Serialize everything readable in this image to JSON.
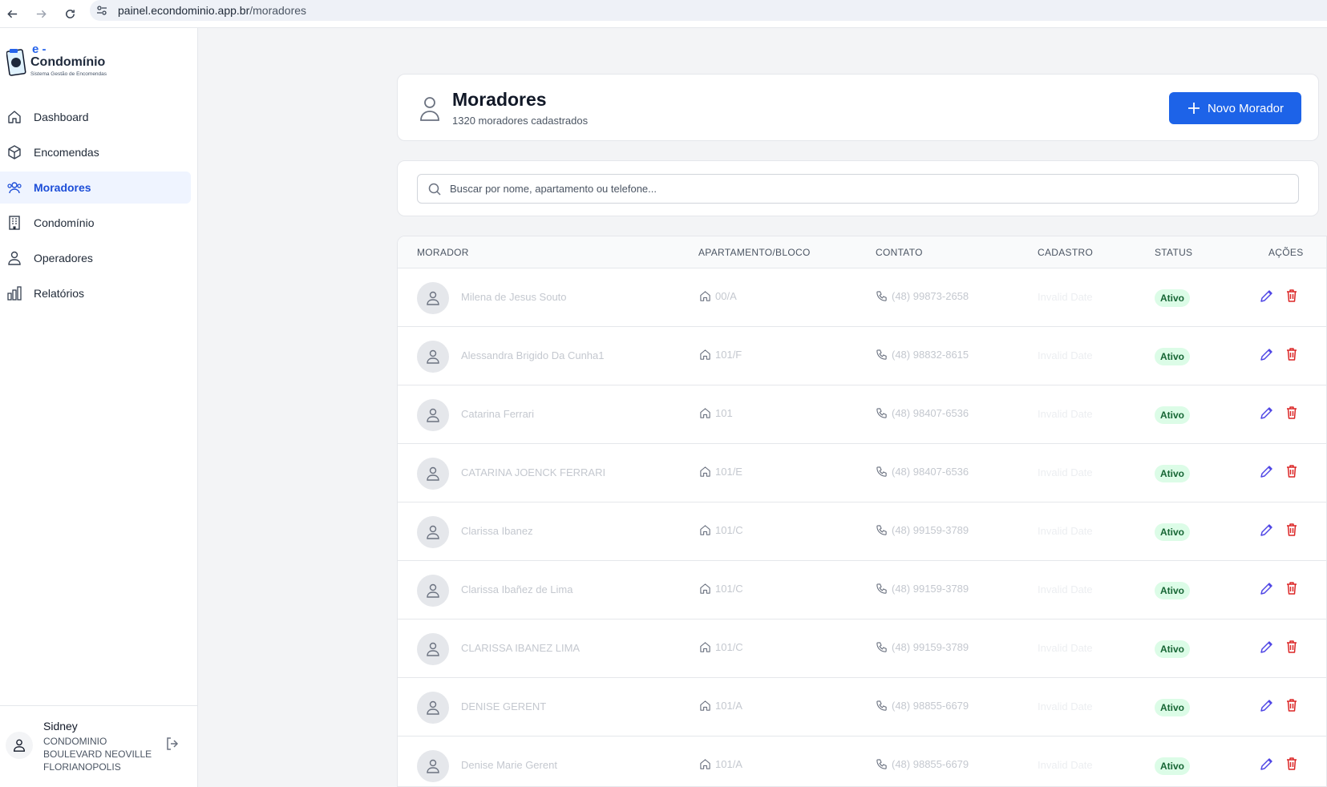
{
  "browser": {
    "url_host": "painel.econdominio.app.br",
    "url_path": "/moradores"
  },
  "sidebar": {
    "logo": {
      "e": "e -",
      "title": "Condomínio",
      "subtitle": "Sistema Gestão de Encomendas"
    },
    "items": [
      {
        "label": "Dashboard",
        "icon": "home-icon"
      },
      {
        "label": "Encomendas",
        "icon": "package-icon"
      },
      {
        "label": "Moradores",
        "icon": "users-icon",
        "active": true
      },
      {
        "label": "Condomínio",
        "icon": "building-icon"
      },
      {
        "label": "Operadores",
        "icon": "user-icon"
      },
      {
        "label": "Relatórios",
        "icon": "bar-chart-icon"
      }
    ],
    "user": {
      "name": "Sidney",
      "org": "CONDOMINIO BOULEVARD NEOVILLE FLORIANOPOLIS"
    }
  },
  "header": {
    "title": "Moradores",
    "subtitle": "1320 moradores cadastrados",
    "new_button": "Novo Morador"
  },
  "search": {
    "placeholder": "Buscar por nome, apartamento ou telefone..."
  },
  "table": {
    "columns": [
      "MORADOR",
      "APARTAMENTO/BLOCO",
      "CONTATO",
      "CADASTRO",
      "STATUS",
      "AÇÕES"
    ],
    "rows": [
      {
        "name": "Milena de Jesus Souto",
        "apt": "00/A",
        "phone": "(48) 99873-2658",
        "date": "Invalid Date",
        "status": "Ativo"
      },
      {
        "name": "Alessandra Brigido Da Cunha1",
        "apt": "101/F",
        "phone": "(48) 98832-8615",
        "date": "Invalid Date",
        "status": "Ativo"
      },
      {
        "name": "Catarina Ferrari",
        "apt": "101",
        "phone": "(48) 98407-6536",
        "date": "Invalid Date",
        "status": "Ativo"
      },
      {
        "name": "CATARINA JOENCK FERRARI",
        "apt": "101/E",
        "phone": "(48) 98407-6536",
        "date": "Invalid Date",
        "status": "Ativo"
      },
      {
        "name": "Clarissa Ibanez",
        "apt": "101/C",
        "phone": "(48) 99159-3789",
        "date": "Invalid Date",
        "status": "Ativo"
      },
      {
        "name": "Clarissa Ibañez de Lima",
        "apt": "101/C",
        "phone": "(48) 99159-3789",
        "date": "Invalid Date",
        "status": "Ativo"
      },
      {
        "name": "CLARISSA IBANEZ LIMA",
        "apt": "101/C",
        "phone": "(48) 99159-3789",
        "date": "Invalid Date",
        "status": "Ativo"
      },
      {
        "name": "DENISE GERENT",
        "apt": "101/A",
        "phone": "(48) 98855-6679",
        "date": "Invalid Date",
        "status": "Ativo"
      },
      {
        "name": "Denise Marie Gerent",
        "apt": "101/A",
        "phone": "(48) 98855-6679",
        "date": "Invalid Date",
        "status": "Ativo"
      }
    ]
  },
  "colors": {
    "accent": "#1d63e8",
    "active_bg": "#eff4ff",
    "badge_bg": "#dcfce7",
    "badge_text": "#166534",
    "edit": "#4f46e5",
    "delete": "#dc2626"
  }
}
